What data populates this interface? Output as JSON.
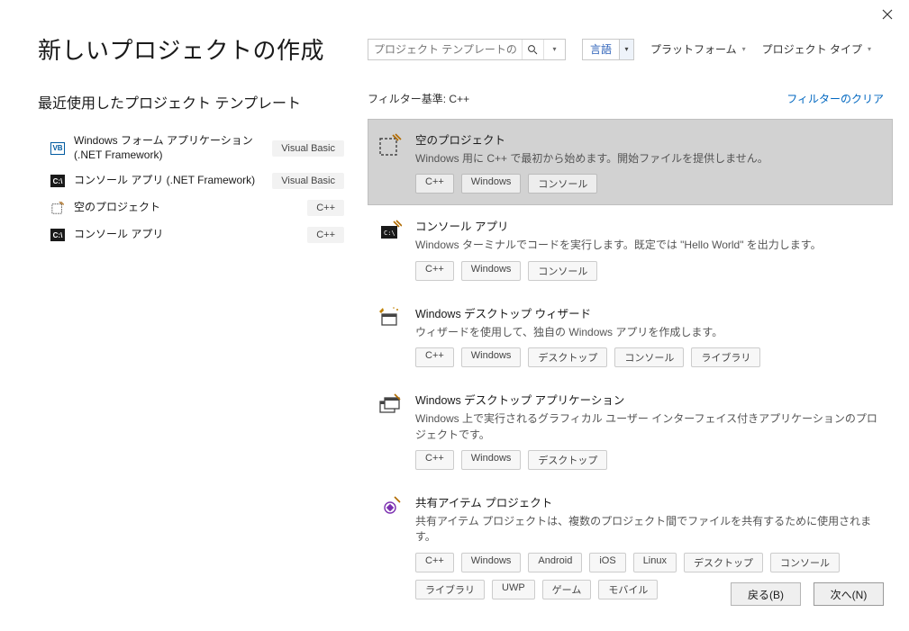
{
  "header": {
    "title": "新しいプロジェクトの作成",
    "search_placeholder": "プロジェクト テンプレートの検索",
    "language_label": "言語",
    "platform_label": "プラットフォーム",
    "project_type_label": "プロジェクト タイプ"
  },
  "left": {
    "recent_heading": "最近使用したプロジェクト テンプレート",
    "items": [
      {
        "icon": "VB",
        "icon_kind": "vb",
        "title": "Windows フォーム アプリケーション (.NET Framework)",
        "badge": "Visual Basic"
      },
      {
        "icon": "C:\\",
        "icon_kind": "cli",
        "title": "コンソール アプリ (.NET Framework)",
        "badge": "Visual Basic"
      },
      {
        "icon": "empty",
        "icon_kind": "empty",
        "title": "空のプロジェクト",
        "badge": "C++"
      },
      {
        "icon": "C:\\",
        "icon_kind": "cli",
        "title": "コンソール アプリ",
        "badge": "C++"
      }
    ]
  },
  "right": {
    "filter_label": "フィルター基準: C++",
    "filter_clear": "フィルターのクリア",
    "templates": [
      {
        "selected": true,
        "icon": "empty-project",
        "title": "空のプロジェクト",
        "desc": "Windows 用に C++ で最初から始めます。開始ファイルを提供しません。",
        "tags": [
          "C++",
          "Windows",
          "コンソール"
        ]
      },
      {
        "selected": false,
        "icon": "console",
        "title": "コンソール アプリ",
        "desc": "Windows ターミナルでコードを実行します。既定では \"Hello World\" を出力します。",
        "tags": [
          "C++",
          "Windows",
          "コンソール"
        ]
      },
      {
        "selected": false,
        "icon": "desktop-wizard",
        "title": "Windows デスクトップ ウィザード",
        "desc": "ウィザードを使用して、独自の Windows アプリを作成します。",
        "tags": [
          "C++",
          "Windows",
          "デスクトップ",
          "コンソール",
          "ライブラリ"
        ]
      },
      {
        "selected": false,
        "icon": "desktop-app",
        "title": "Windows デスクトップ アプリケーション",
        "desc": "Windows 上で実行されるグラフィカル ユーザー インターフェイス付きアプリケーションのプロジェクトです。",
        "tags": [
          "C++",
          "Windows",
          "デスクトップ"
        ]
      },
      {
        "selected": false,
        "icon": "shared-items",
        "title": "共有アイテム プロジェクト",
        "desc": "共有アイテム プロジェクトは、複数のプロジェクト間でファイルを共有するために使用されます。",
        "tags": [
          "C++",
          "Windows",
          "Android",
          "iOS",
          "Linux",
          "デスクトップ",
          "コンソール",
          "ライブラリ",
          "UWP",
          "ゲーム",
          "モバイル"
        ]
      }
    ]
  },
  "footer": {
    "back": "戻る(B)",
    "next": "次へ(N)"
  }
}
